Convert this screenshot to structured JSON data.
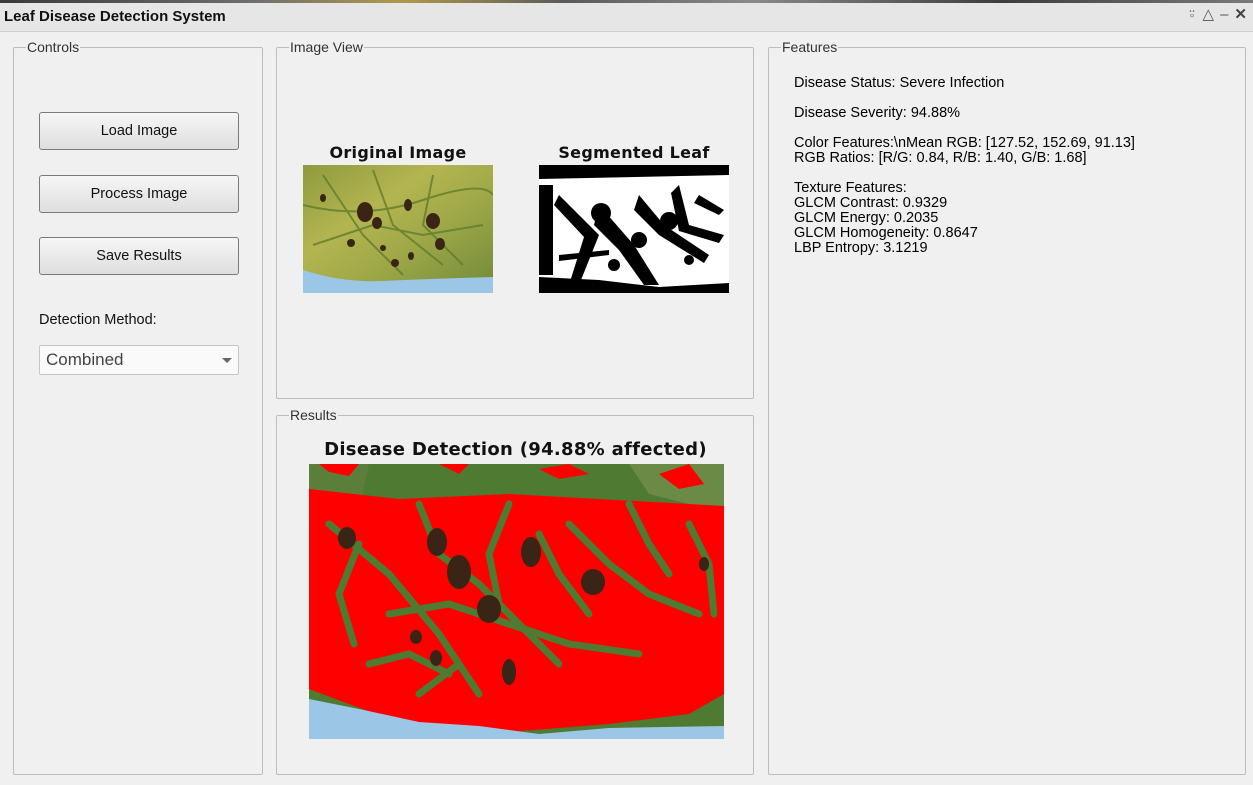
{
  "window": {
    "title": "Leaf Disease Detection System",
    "icons": [
      "pin-icon",
      "undock-icon",
      "minimize-icon",
      "close-icon"
    ]
  },
  "controls": {
    "label": "Controls",
    "load_label": "Load Image",
    "process_label": "Process Image",
    "save_label": "Save Results",
    "method_label": "Detection Method:",
    "method_value": "Combined"
  },
  "image_view": {
    "label": "Image View",
    "original_title": "Original Image",
    "segmented_title": "Segmented Leaf"
  },
  "results": {
    "label": "Results",
    "detection_title": "Disease Detection (94.88% affected)",
    "affected_percent": 94.88
  },
  "features": {
    "label": "Features",
    "status": "Disease Status: Severe Infection",
    "severity": "Disease Severity: 94.88%",
    "color_header": "Color Features:\\nMean RGB: [127.52, 152.69, 91.13]",
    "rgb_ratios": "RGB Ratios: [R/G: 0.84, R/B: 1.40, G/B: 1.68]",
    "texture_header": "Texture Features:",
    "glcm_contrast": "GLCM Contrast: 0.9329",
    "glcm_energy": "GLCM Energy: 0.2035",
    "glcm_homogeneity": "GLCM Homogeneity: 0.8647",
    "lbp_entropy": "LBP Entropy: 3.1219"
  },
  "colors": {
    "background": "#f0f0f0",
    "highlight": "#ff0000",
    "leaf_green": "#5e8a3a",
    "leaf_yellow": "#b9bb55",
    "lesion": "#3a2416",
    "sky": "#9cc6e6"
  }
}
